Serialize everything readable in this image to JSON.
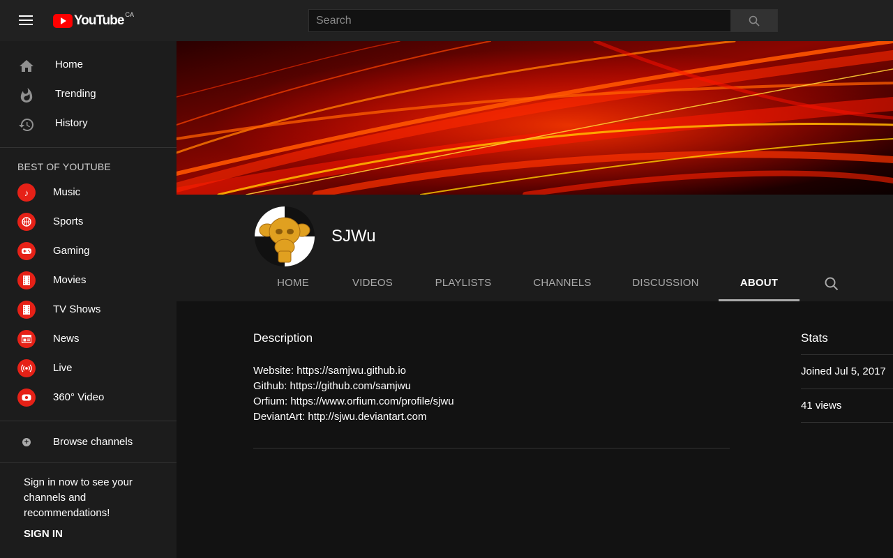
{
  "masthead": {
    "logo_text": "YouTube",
    "country": "CA",
    "search_placeholder": "Search"
  },
  "sidebar": {
    "nav": [
      {
        "label": "Home",
        "icon": "home-icon"
      },
      {
        "label": "Trending",
        "icon": "trending-icon"
      },
      {
        "label": "History",
        "icon": "history-icon"
      }
    ],
    "section_title": "BEST OF YOUTUBE",
    "best": [
      {
        "label": "Music",
        "icon": "music-icon"
      },
      {
        "label": "Sports",
        "icon": "sports-icon"
      },
      {
        "label": "Gaming",
        "icon": "gaming-icon"
      },
      {
        "label": "Movies",
        "icon": "movies-icon"
      },
      {
        "label": "TV Shows",
        "icon": "tv-shows-icon"
      },
      {
        "label": "News",
        "icon": "news-icon"
      },
      {
        "label": "Live",
        "icon": "live-icon"
      },
      {
        "label": "360° Video",
        "icon": "360-video-icon"
      }
    ],
    "browse_label": "Browse channels",
    "signin_text": "Sign in now to see your channels and recommendations!",
    "signin_button": "SIGN IN"
  },
  "channel": {
    "name": "SJWu",
    "tabs": [
      "HOME",
      "VIDEOS",
      "PLAYLISTS",
      "CHANNELS",
      "DISCUSSION",
      "ABOUT"
    ],
    "active_tab": "ABOUT"
  },
  "about": {
    "description_title": "Description",
    "lines": [
      {
        "label": "Website: ",
        "link": "https://samjwu.github.io"
      },
      {
        "label": "Github: ",
        "link": "https://github.com/samjwu"
      },
      {
        "label": "Orfium: ",
        "link": "https://www.orfium.com/profile/sjwu"
      },
      {
        "label": "DeviantArt: ",
        "link": "http://sjwu.deviantart.com"
      }
    ],
    "stats_title": "Stats",
    "joined": "Joined Jul 5, 2017",
    "views": "41 views"
  },
  "colors": {
    "accent": "#ff0000",
    "sidebar_bg": "#1c1c1c",
    "page_bg": "#121212",
    "masthead_bg": "#212121"
  }
}
